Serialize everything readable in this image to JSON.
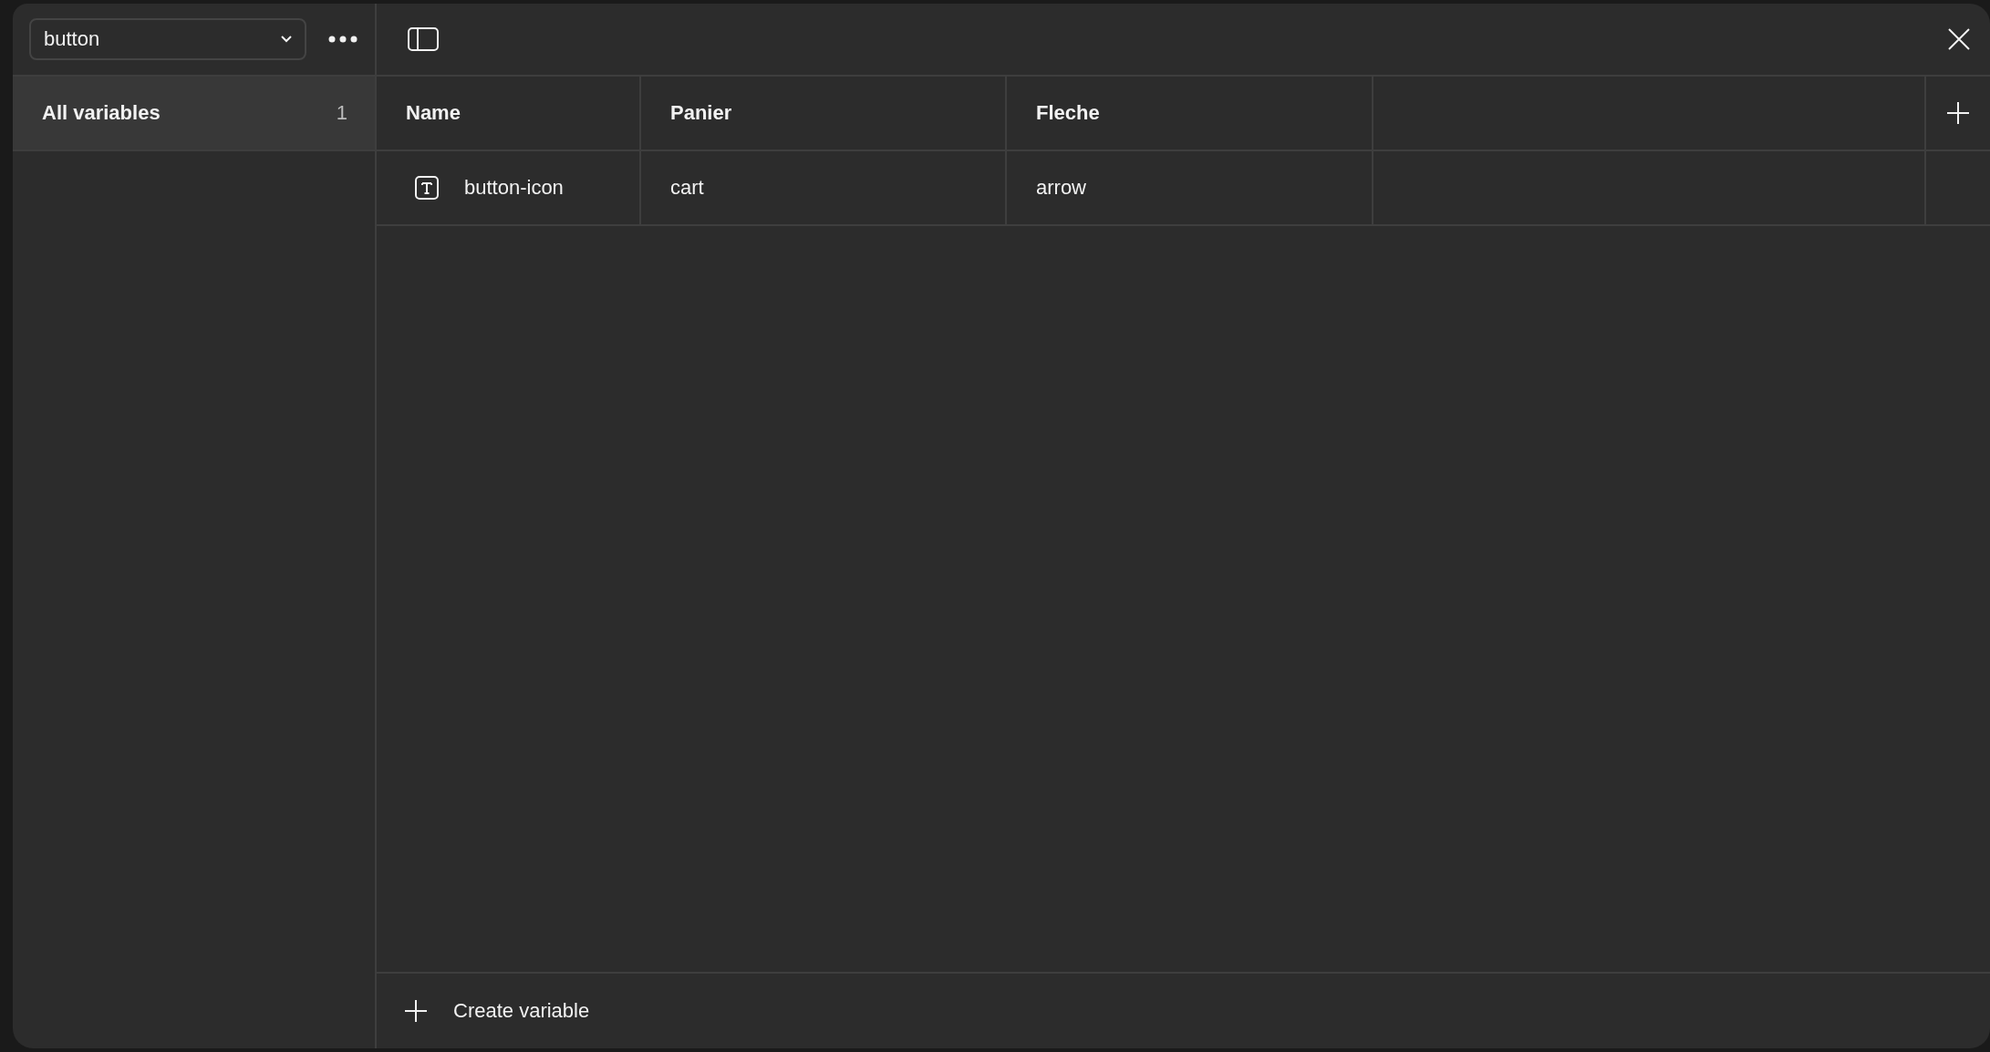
{
  "dropdown": {
    "value": "button"
  },
  "sidebar": {
    "items": [
      {
        "label": "All variables",
        "count": "1",
        "selected": true
      }
    ]
  },
  "table": {
    "columns": [
      "Name",
      "Panier",
      "Fleche"
    ],
    "rows": [
      {
        "name": "button-icon",
        "values": [
          "cart",
          "arrow"
        ]
      }
    ]
  },
  "footer": {
    "create_label": "Create variable"
  }
}
